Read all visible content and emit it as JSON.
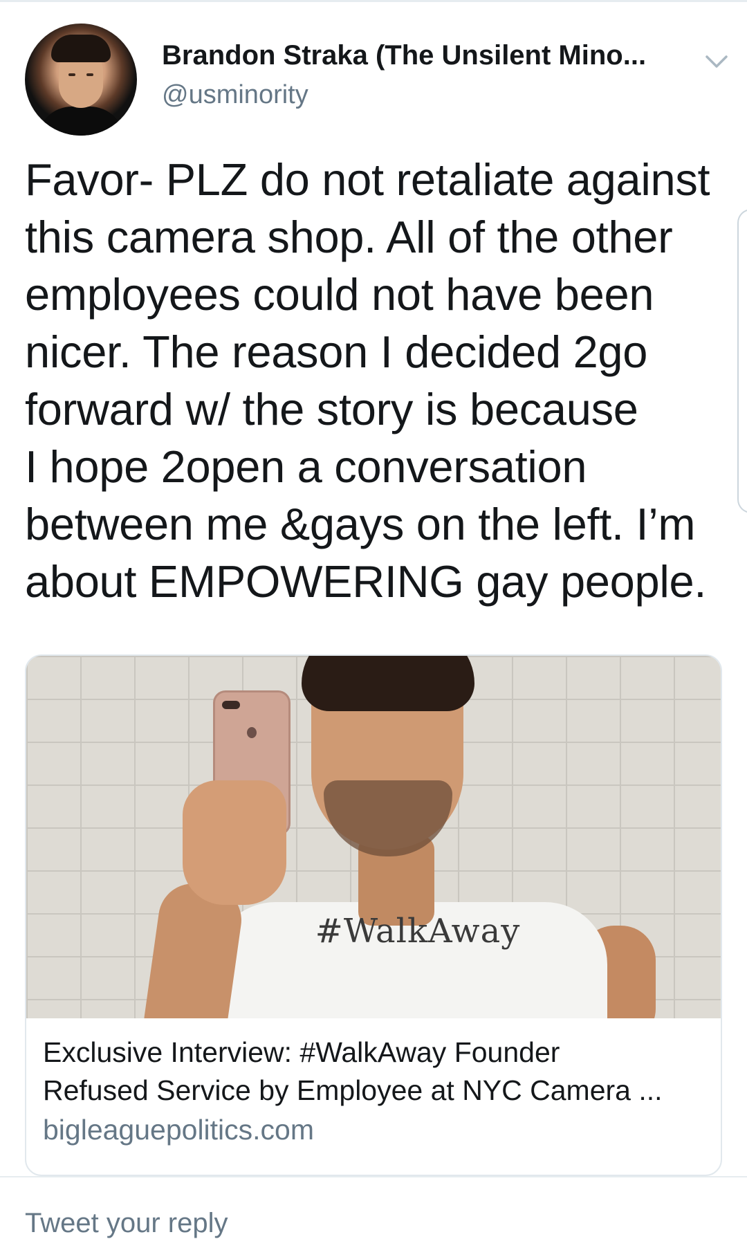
{
  "tweet": {
    "author_name": "Brandon Straka (The Unsilent Mino...",
    "author_handle": "@usminority",
    "lines": [
      "Favor- PLZ do not retaliate against",
      "this camera shop. All of the other",
      "employees could not have been",
      "nicer. The reason I decided 2go",
      "forward w/ the story is because",
      "I hope 2open a conversation",
      "between me &gays on the left. I’m",
      "about EMPOWERING gay people."
    ]
  },
  "card": {
    "image_caption_text": "#WalkAway",
    "title_line1": "Exclusive Interview: #WalkAway Founder",
    "title_line2": "Refused Service by Employee at NYC Camera ...",
    "domain": "bigleaguepolitics.com"
  },
  "reply": {
    "placeholder": "Tweet your reply"
  },
  "icons": {
    "more": "chevron-down-icon"
  },
  "colors": {
    "primary_text": "#14171a",
    "secondary_text": "#657786",
    "border": "#e1e8ed"
  }
}
